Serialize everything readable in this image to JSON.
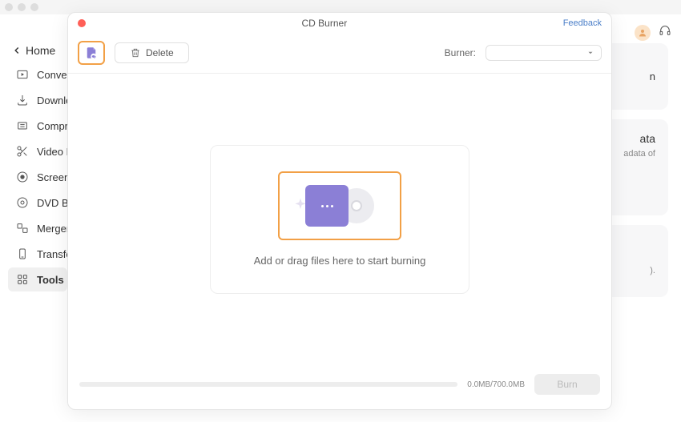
{
  "home_label": "Home",
  "sidebar": {
    "items": [
      {
        "label": "Converter"
      },
      {
        "label": "Downloader"
      },
      {
        "label": "Compressor"
      },
      {
        "label": "Video Editor"
      },
      {
        "label": "Screen Recorder"
      },
      {
        "label": "DVD Burner"
      },
      {
        "label": "Merger"
      },
      {
        "label": "Transfer"
      },
      {
        "label": "Tools"
      }
    ]
  },
  "bg": {
    "title1": "n",
    "title2": "ata",
    "desc": "adata of"
  },
  "modal": {
    "title": "CD Burner",
    "feedback": "Feedback",
    "delete_label": "Delete",
    "burner_label": "Burner:",
    "drop_text": "Add or drag files here to start burning",
    "progress_label": "0.0MB/700.0MB",
    "burn_label": "Burn"
  }
}
